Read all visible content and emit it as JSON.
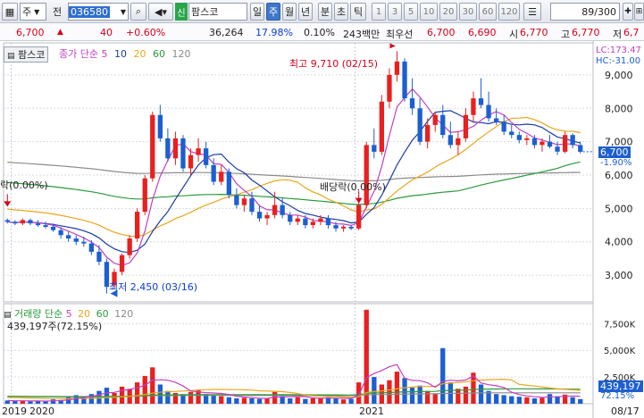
{
  "toolbar": {
    "market": "주",
    "market_kind": "전",
    "stock_code": "036580",
    "credit_badge": "신",
    "stock_name": "팜스코",
    "periods": [
      "일",
      "주",
      "월",
      "년",
      "분",
      "초",
      "틱"
    ],
    "active_period": "주",
    "intervals": [
      "1",
      "3",
      "5",
      "10",
      "20",
      "30",
      "60",
      "120"
    ],
    "count": "89",
    "count_total": "/300"
  },
  "pricebar": {
    "price": "6,700",
    "change": "40",
    "change_pct": "+0.60%",
    "volume": "36,264",
    "turnover_pct": "17.98%",
    "ratio_pct": "0.10%",
    "trade_value": "243백만",
    "best_ask_label": "최우선",
    "best_ask": "6,700",
    "best_bid": "6,690",
    "open_label": "시",
    "open": "6,770",
    "high_label": "고",
    "high": "6,770",
    "low_label": "저",
    "low": "6,7"
  },
  "chart": {
    "stock_label": "팜스코",
    "price_indicator_title": "종가 단순",
    "ma_periods": [
      "5",
      "10",
      "20",
      "60",
      "120"
    ],
    "lc_label": "LC:173.47",
    "hc_label": "HC:-31.00",
    "high_annotation": "최고 9,710 (02/15)",
    "low_annotation": "최저 2,450 (03/16)",
    "ex_right_left": "락(0.00%)",
    "ex_dividend": "배당락(0.00%)",
    "current_price_tag": "6,700",
    "current_change_tag": "-1.90%",
    "volume_indicator_title": "거래량 단순",
    "volume_ma_periods": [
      "5",
      "20",
      "60",
      "120"
    ],
    "volume_value_label": "439,197주(72.15%)",
    "volume_tag": "439,197",
    "volume_pct_tag": "72.15%",
    "x_labels": [
      "2019",
      "2020",
      "2021",
      "08/17"
    ],
    "price_axis": [
      "9,000",
      "8,000",
      "7,000",
      "6,000",
      "5,000",
      "4,000",
      "3,000"
    ],
    "volume_axis": [
      "7,500K",
      "5,000K",
      "2,500K"
    ]
  },
  "colors": {
    "up": "#e8201f",
    "down": "#1c5fd0",
    "ma5": "#c23fc4",
    "ma10": "#1a3ca8",
    "ma20": "#eaa61b",
    "ma60": "#2a9a3a",
    "ma120": "#8b8b8b"
  },
  "chart_data": {
    "type": "candlestick",
    "x_axis_years": [
      "2019",
      "2020",
      "2021"
    ],
    "ylim": [
      2200,
      9800
    ],
    "candles": [
      [
        4650,
        4700,
        4550,
        4600
      ],
      [
        4600,
        4650,
        4500,
        4550
      ],
      [
        4550,
        4700,
        4500,
        4650
      ],
      [
        4650,
        4700,
        4500,
        4550
      ],
      [
        4550,
        4650,
        4450,
        4500
      ],
      [
        4500,
        4600,
        4400,
        4450
      ],
      [
        4450,
        4550,
        4300,
        4350
      ],
      [
        4350,
        4450,
        4100,
        4200
      ],
      [
        4200,
        4300,
        4000,
        4100
      ],
      [
        4100,
        4200,
        3900,
        4000
      ],
      [
        4000,
        4150,
        3850,
        3950
      ],
      [
        3950,
        4050,
        3600,
        3700
      ],
      [
        3700,
        3900,
        3300,
        3400
      ],
      [
        3400,
        3500,
        2450,
        2650
      ],
      [
        2700,
        3200,
        2600,
        3100
      ],
      [
        3100,
        3650,
        3000,
        3600
      ],
      [
        3600,
        4200,
        3500,
        4100
      ],
      [
        4100,
        5000,
        4000,
        4900
      ],
      [
        4900,
        6000,
        4800,
        5900
      ],
      [
        5900,
        7900,
        5800,
        7800
      ],
      [
        7800,
        8100,
        7000,
        7100
      ],
      [
        7100,
        7400,
        6400,
        6500
      ],
      [
        6500,
        7300,
        6300,
        7100
      ],
      [
        7100,
        7200,
        6100,
        6200
      ],
      [
        6200,
        6800,
        6000,
        6600
      ],
      [
        6600,
        7100,
        6400,
        6800
      ],
      [
        6800,
        7000,
        6200,
        6300
      ],
      [
        6300,
        6500,
        5700,
        5800
      ],
      [
        5800,
        6300,
        5700,
        6100
      ],
      [
        6100,
        6200,
        5300,
        5400
      ],
      [
        5400,
        5600,
        5000,
        5100
      ],
      [
        5100,
        5400,
        4900,
        5300
      ],
      [
        5300,
        5500,
        4800,
        4900
      ],
      [
        4900,
        5100,
        4600,
        4700
      ],
      [
        4700,
        4900,
        4500,
        4800
      ],
      [
        4800,
        5500,
        4700,
        5100
      ],
      [
        5100,
        5300,
        4700,
        4800
      ],
      [
        4800,
        4900,
        4500,
        4600
      ],
      [
        4600,
        4800,
        4500,
        4700
      ],
      [
        4700,
        4800,
        4400,
        4500
      ],
      [
        4500,
        4700,
        4400,
        4600
      ],
      [
        4600,
        4800,
        4500,
        4700
      ],
      [
        4700,
        4800,
        4400,
        4500
      ],
      [
        4500,
        4600,
        4300,
        4400
      ],
      [
        4400,
        4500,
        4300,
        4450
      ],
      [
        4450,
        4500,
        4350,
        4400
      ],
      [
        4400,
        5200,
        4350,
        5100
      ],
      [
        5100,
        7000,
        5000,
        6900
      ],
      [
        6900,
        7400,
        6500,
        6700
      ],
      [
        6700,
        8400,
        6600,
        8200
      ],
      [
        8200,
        9200,
        8000,
        9000
      ],
      [
        9000,
        9710,
        8800,
        9400
      ],
      [
        9400,
        9500,
        8200,
        8300
      ],
      [
        8300,
        8900,
        7800,
        8000
      ],
      [
        8000,
        8300,
        6900,
        7000
      ],
      [
        7000,
        7700,
        6800,
        7500
      ],
      [
        7500,
        7900,
        7300,
        7800
      ],
      [
        7800,
        8100,
        7100,
        7200
      ],
      [
        7200,
        7600,
        6800,
        6900
      ],
      [
        6900,
        7300,
        6600,
        7100
      ],
      [
        7100,
        8000,
        7000,
        7800
      ],
      [
        7800,
        8500,
        7600,
        8300
      ],
      [
        8300,
        8900,
        8000,
        8100
      ],
      [
        8100,
        8500,
        7600,
        7700
      ],
      [
        7700,
        8000,
        7500,
        7600
      ],
      [
        7600,
        7800,
        7200,
        7300
      ],
      [
        7300,
        7500,
        7100,
        7200
      ],
      [
        7200,
        7300,
        6950,
        7050
      ],
      [
        7050,
        7200,
        6900,
        7100
      ],
      [
        7100,
        7200,
        6800,
        6900
      ],
      [
        6900,
        7100,
        6700,
        7000
      ],
      [
        7000,
        7200,
        6800,
        6850
      ],
      [
        6850,
        7000,
        6600,
        6700
      ],
      [
        6700,
        7300,
        6650,
        7200
      ],
      [
        7200,
        7250,
        6800,
        6900
      ],
      [
        6900,
        7000,
        6650,
        6700
      ]
    ],
    "volumes": [
      300,
      250,
      280,
      200,
      260,
      220,
      400,
      350,
      600,
      800,
      700,
      900,
      1200,
      1500,
      1000,
      1600,
      1400,
      2000,
      2600,
      3400,
      1800,
      1200,
      1000,
      900,
      1100,
      1300,
      900,
      800,
      700,
      600,
      500,
      550,
      500,
      450,
      480,
      1100,
      700,
      500,
      600,
      450,
      500,
      550,
      600,
      500,
      400,
      450,
      2000,
      8800,
      2500,
      1800,
      2200,
      3000,
      2400,
      1500,
      1700,
      1200,
      900,
      5200,
      2000,
      1400,
      1600,
      2900,
      1800,
      1200,
      900,
      800,
      700,
      650,
      600,
      500,
      550,
      900,
      700,
      850,
      600,
      439
    ]
  }
}
